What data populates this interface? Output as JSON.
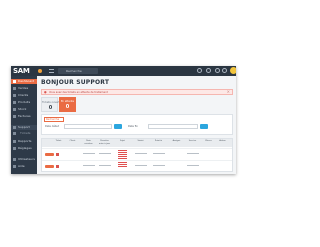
{
  "app": {
    "logo": "SAM",
    "search_placeholder": "Recherche"
  },
  "sidebar": {
    "items": [
      {
        "label": "Dashboard",
        "state": "active"
      },
      {
        "label": "Ventes",
        "state": "normal"
      },
      {
        "label": "Clients",
        "state": "normal"
      },
      {
        "label": "Produits",
        "state": "normal"
      },
      {
        "label": "Stock",
        "state": "normal"
      },
      {
        "label": "Factures",
        "state": "normal"
      },
      {
        "label": "Support",
        "state": "highlight"
      },
      {
        "label": "Tickets",
        "state": "sub"
      },
      {
        "label": "Rapports",
        "state": "normal"
      },
      {
        "label": "Réglages",
        "state": "normal"
      },
      {
        "label": "Utilisateurs",
        "state": "normal"
      },
      {
        "label": "Aide",
        "state": "normal"
      }
    ]
  },
  "page": {
    "title": "BONJOUR SUPPORT",
    "alert": {
      "icon": "alert-icon",
      "text": "Vous avez des tickets en attente de traitement",
      "close": "×"
    },
    "stats": [
      {
        "label": "Tickets ouverts",
        "value": "0"
      },
      {
        "label": "En attente",
        "value": "0"
      }
    ]
  },
  "filters": {
    "tab_label": "Recherche",
    "fields": [
      {
        "label": "Date début"
      },
      {
        "label": "Date fin"
      }
    ]
  },
  "table": {
    "headers": [
      "",
      "Ticket",
      "Client",
      "Date création",
      "Dernière mise à jour",
      "Sujet",
      "Statut",
      "Priorité",
      "Assigné",
      "Service",
      "Pièces",
      "Action"
    ],
    "rows": [
      {
        "id": "1"
      },
      {
        "id": "2"
      }
    ]
  },
  "colors": {
    "accent": "#ea6b43",
    "sidebar": "#2e3a48",
    "topbar": "#2b3642",
    "primary_button": "#2ca6de",
    "alert_bg": "#fde8e6",
    "alert_text": "#b8433f"
  }
}
